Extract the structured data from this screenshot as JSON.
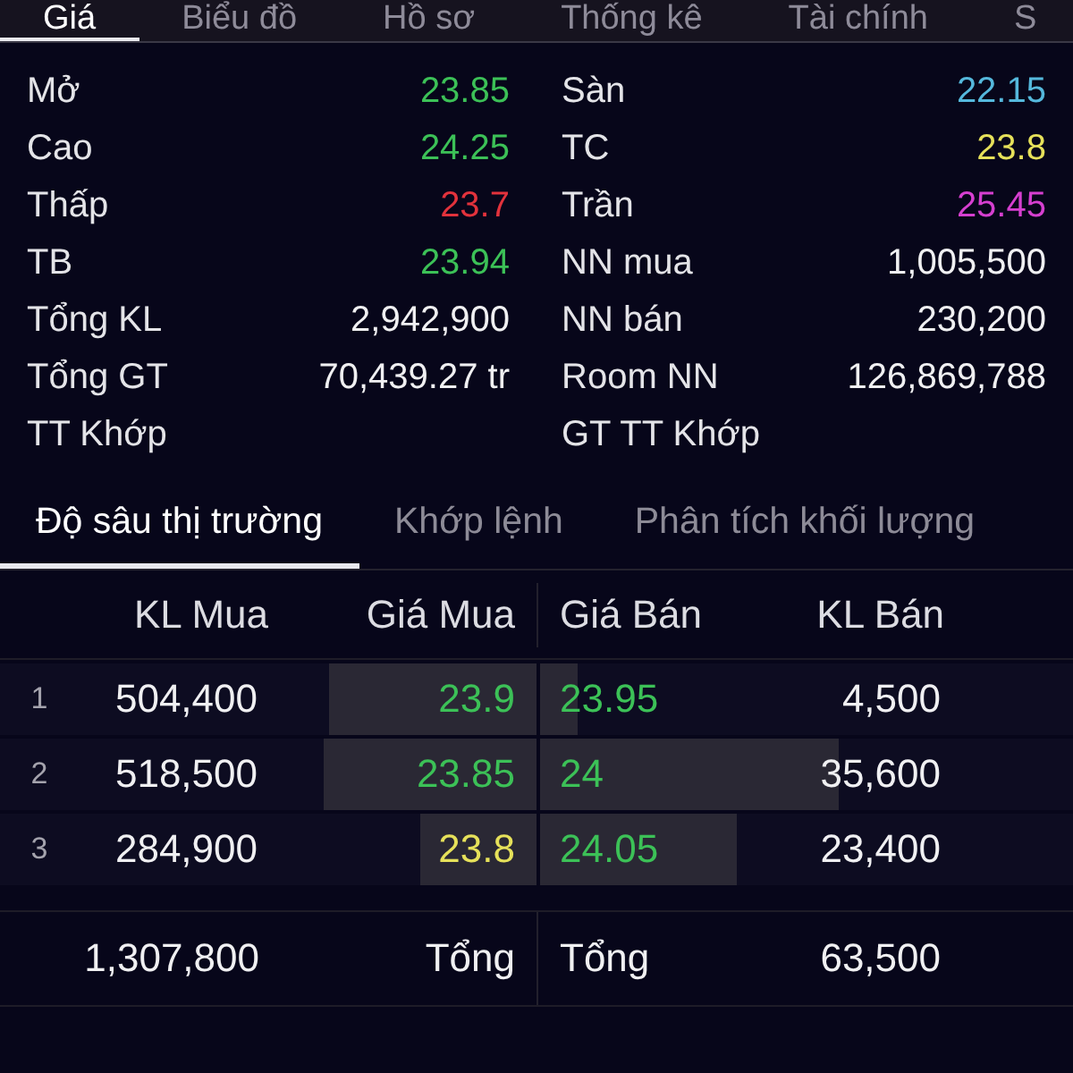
{
  "top_tabs": [
    {
      "label": "Giá",
      "selected": true
    },
    {
      "label": "Biểu đồ",
      "selected": false
    },
    {
      "label": "Hồ sơ",
      "selected": false
    },
    {
      "label": "Thống kê",
      "selected": false
    },
    {
      "label": "Tài chính",
      "selected": false
    },
    {
      "label": "S",
      "selected": false
    }
  ],
  "stats": {
    "left": [
      {
        "label": "Mở",
        "value": "23.85",
        "color": "#3cc157"
      },
      {
        "label": "Cao",
        "value": "24.25",
        "color": "#3cc157"
      },
      {
        "label": "Thấp",
        "value": "23.7",
        "color": "#e2323c"
      },
      {
        "label": "TB",
        "value": "23.94",
        "color": "#3cc157"
      },
      {
        "label": "Tổng KL",
        "value": "2,942,900",
        "color": "#f0f0f2"
      },
      {
        "label": "Tổng GT",
        "value": "70,439.27 tr",
        "color": "#f0f0f2"
      },
      {
        "label": "TT Khớp"
      }
    ],
    "right": [
      {
        "label": "Sàn",
        "value": "22.15",
        "color": "#55b8dc"
      },
      {
        "label": "TC",
        "value": "23.8",
        "color": "#e6e15a"
      },
      {
        "label": "Trần",
        "value": "25.45",
        "color": "#d63fd0"
      },
      {
        "label": "NN mua",
        "value": "1,005,500",
        "color": "#f0f0f2"
      },
      {
        "label": "NN bán",
        "value": "230,200",
        "color": "#f0f0f2"
      },
      {
        "label": "Room NN",
        "value": "126,869,788",
        "color": "#f0f0f2"
      },
      {
        "label": "GT TT Khớp"
      }
    ]
  },
  "depth_tabs": [
    {
      "label": "Độ sâu thị trường",
      "selected": true
    },
    {
      "label": "Khớp lệnh",
      "selected": false
    },
    {
      "label": "Phân tích khối lượng",
      "selected": false
    }
  ],
  "order_book": {
    "columns": [
      "KL Mua",
      "Giá Mua",
      "Giá Bán",
      "KL Bán"
    ],
    "rows": [
      {
        "index": "1",
        "bid": {
          "volume": "504,400",
          "price": "23.9",
          "color": "#3cc157",
          "level": 0.386
        },
        "ask": {
          "price": "23.95",
          "color": "#3cc157",
          "volume": "4,500",
          "level": 0.071
        }
      },
      {
        "index": "2",
        "bid": {
          "volume": "518,500",
          "price": "23.85",
          "color": "#3cc157",
          "level": 0.396
        },
        "ask": {
          "price": "24",
          "color": "#3cc157",
          "volume": "35,600",
          "level": 0.561
        }
      },
      {
        "index": "3",
        "bid": {
          "volume": "284,900",
          "price": "23.8",
          "color": "#e6e15a",
          "level": 0.218
        },
        "ask": {
          "price": "24.05",
          "color": "#3cc157",
          "volume": "23,400",
          "level": 0.369
        }
      }
    ],
    "total": {
      "bid_volume": "1,307,800",
      "bid_label": "Tổng",
      "ask_label": "Tổng",
      "ask_volume": "63,500"
    }
  }
}
